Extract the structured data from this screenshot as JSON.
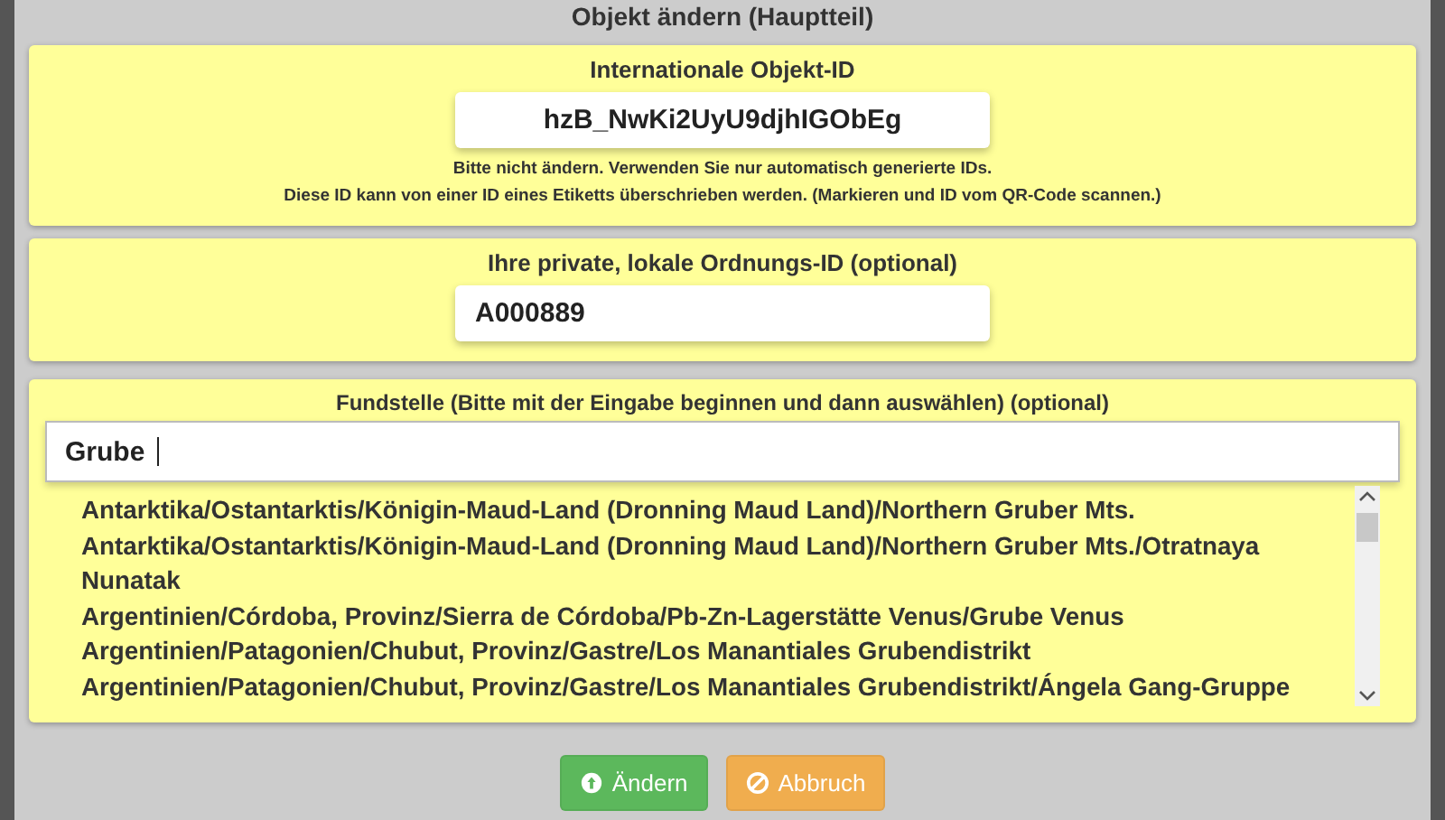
{
  "title": "Objekt ändern (Hauptteil)",
  "international_id": {
    "label": "Internationale Objekt-ID",
    "value": "hzB_NwKi2UyU9djhIGObEg",
    "notes": [
      "Bitte nicht ändern. Verwenden Sie nur automatisch generierte IDs.",
      "Diese ID kann von einer ID eines Etiketts überschrieben werden. (Markieren und ID vom QR-Code scannen.)"
    ]
  },
  "local_id": {
    "label": "Ihre private, lokale Ordnungs-ID (optional)",
    "value": "A000889"
  },
  "locality": {
    "label": "Fundstelle (Bitte mit der Eingabe beginnen und dann auswählen) (optional)",
    "value": "Grube ",
    "suggestions": [
      "Antarktika/Ostantarktis/Königin-Maud-Land (Dronning Maud Land)/Northern Gruber Mts.",
      "Antarktika/Ostantarktis/Königin-Maud-Land (Dronning Maud Land)/Northern Gruber Mts./Otratnaya Nunatak",
      "Argentinien/Córdoba, Provinz/Sierra de Córdoba/Pb-Zn-Lagerstätte Venus/Grube Venus",
      "Argentinien/Patagonien/Chubut, Provinz/Gastre/Los Manantiales Grubendistrikt",
      "Argentinien/Patagonien/Chubut, Provinz/Gastre/Los Manantiales Grubendistrikt/Ángela Gang-Gruppe"
    ]
  },
  "buttons": [
    {
      "label": "Ändern",
      "kind": "submit"
    },
    {
      "label": "Abbruch",
      "kind": "cancel"
    }
  ]
}
